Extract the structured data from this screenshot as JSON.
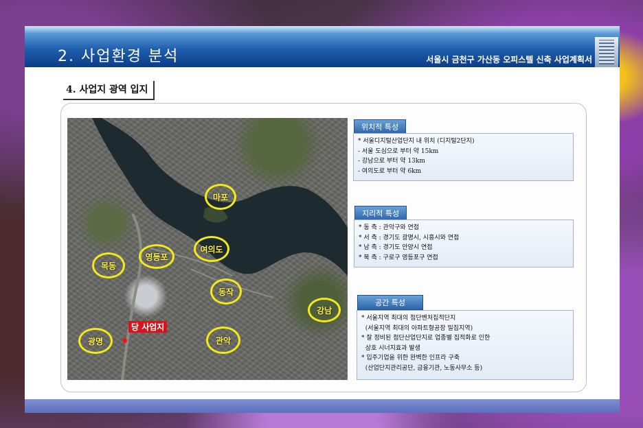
{
  "header": {
    "title": "2. 사업환경 분석",
    "subtitle": "서울시 금천구 가산동 오피스텔 신축 사업계획서"
  },
  "section_title": "4. 사업지 광역 입지",
  "map": {
    "labels": [
      "마포",
      "여의도",
      "영등포",
      "목동",
      "동작",
      "강남",
      "광명",
      "관악"
    ],
    "site_label": "당 사업지"
  },
  "panels": [
    {
      "tag": "위치적 특성",
      "lines": [
        "* 서울디지털산업단지 내 위치 (디지털2단지)",
        "- 서울 도심으로 부터 약 15km",
        "- 강남으로 부터 약 13km",
        "- 여의도로 부터 약 6km"
      ]
    },
    {
      "tag": "지리적 특성",
      "lines": [
        "* 동 측 : 관악구와 연접",
        "* 서 측 : 경기도 광명시, 시흥시와 연접",
        "* 남 측 : 경기도 안양시 연접",
        "* 북 측 : 구로구 영등포구 연접"
      ]
    },
    {
      "tag": "공간 특성",
      "lines": [
        "* 서울지역 최대의 첨단벤처집적단지",
        "  (서울지역 최대의 아파트형공장 밀집지역)",
        "* 잘 정비된 첨단산업단지로 업종별 집적화로 인한",
        "  상호 시너지효과 발생",
        "* 입주기업을 위한 완벽한 인프라 구축",
        "  (산업단지관리공단, 금융기관, 노동사무소 등)"
      ]
    }
  ]
}
